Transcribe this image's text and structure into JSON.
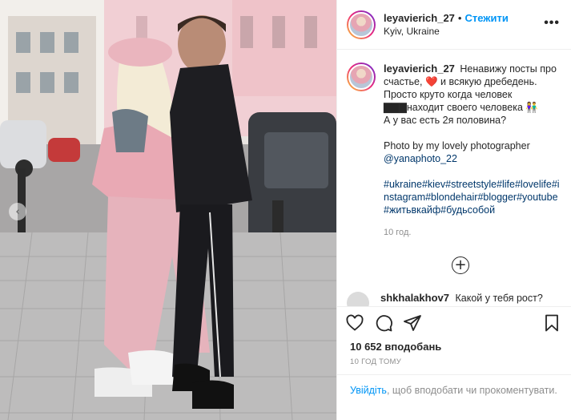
{
  "post": {
    "username": "leyavierich_27",
    "follow_label": "Стежити",
    "separator": "•",
    "location": "Kyiv, Ukraine",
    "more_label": "•••"
  },
  "caption": {
    "username": "leyavierich_27",
    "text_line_1": "Ненавижу посты про счастье, ❤️ и всякую дребедень. Просто круто когда человек ▇▇▇находит своего человека 👫",
    "text_line_2": "А у вас есть 2я половина?",
    "photo_credit": "Photo by my lovely photographer",
    "mention": "@yanaphoto_22",
    "hashtags": "#ukraine#kiev#streetstyle#life#lovelife#instagram#blondehair#blogger#youtube#житьвкайф#будьсобой",
    "time": "10 год."
  },
  "load_more_label": "+",
  "comment": {
    "username": "shkhalakhov7",
    "text": "Какой у тебя рост?"
  },
  "likes_text": "10 652 вподобань",
  "time_ago": "10 ГОД ТОМУ",
  "login": {
    "link": "Увійдіть",
    "rest": ", щоб вподобати чи прокоментувати."
  },
  "carousel": {
    "prev_label": "‹"
  },
  "colors": {
    "accent": "#0095f6",
    "link": "#00376b",
    "muted": "#8e8e8e"
  },
  "icons": [
    "heart-icon",
    "comment-icon",
    "share-icon",
    "bookmark-icon",
    "plus-circle-icon",
    "more-icon",
    "chevron-left-icon"
  ]
}
